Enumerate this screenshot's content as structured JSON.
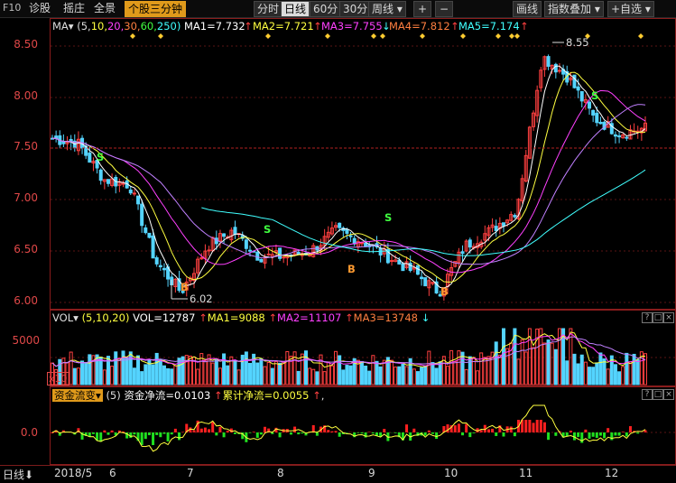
{
  "toolbar": {
    "f10": "F10",
    "diagnose": "诊股",
    "draw": "摇庄",
    "overview": "全景",
    "stock_3min": "个股三分钟",
    "timeshare": "分时",
    "daily": "日线",
    "min60": "60分",
    "min30": "30分",
    "weekly": "周线",
    "plus": "+",
    "minus": "−",
    "line_draw": "画线",
    "index_overlay": "指数叠加",
    "self_select": "+自选"
  },
  "main_legend": {
    "name": "MA▾",
    "params_open": "(5,",
    "p10": "10,",
    "p20": "20,",
    "p30": "30,",
    "p60": "60,",
    "p250": "250)",
    "ma1": "MA1=7.732",
    "ma2": "MA2=7.721",
    "ma3": "MA3=7.755",
    "ma4": "MA4=7.812",
    "ma5": "MA5=7.174",
    "up_arrow": "↑",
    "down_arrow": "↓"
  },
  "price_axis": [
    "8.50",
    "8.00",
    "7.50",
    "7.00",
    "6.50",
    "6.00"
  ],
  "annotations": {
    "high": "8.55",
    "low": "6.02",
    "buy": "B",
    "sell": "S"
  },
  "vol_legend": {
    "name": "VOL▾",
    "params": "(5,10,20)",
    "vol": "VOL=12787",
    "ma1": "MA1=9088",
    "ma2": "MA2=11107",
    "ma3": "MA3=13748"
  },
  "vol_axis": {
    "top": "5000",
    "unit": "x10"
  },
  "fund_legend": {
    "name": "资金流变▾",
    "param": "(5)",
    "net": "资金净流=0.0103",
    "cum": "累计净流=0.0055",
    "trail": ","
  },
  "fund_axis": {
    "zero": "0.0"
  },
  "bottom": {
    "period": "日线",
    "period_arrow": "⬇",
    "start": "2018/5",
    "months": [
      "6",
      "7",
      "8",
      "9",
      "10",
      "11",
      "12"
    ]
  },
  "colors": {
    "up": "#ff4040",
    "down": "#54d4ff",
    "ma5": "#ffffff",
    "ma10": "#ffff40",
    "ma20": "#ff40ff",
    "ma30": "#c080ff",
    "ma60": "#40ffff",
    "accent": "#e09a1b"
  },
  "chart_data": {
    "type": "line",
    "xlabel": "",
    "ylabel": "",
    "ylim": [
      6.0,
      8.6
    ],
    "categories": [
      "2018/5",
      "6",
      "7",
      "8",
      "9",
      "10",
      "11",
      "12"
    ],
    "price_close_approx": [
      7.6,
      7.55,
      7.2,
      7.15,
      6.4,
      6.1,
      6.55,
      6.7,
      6.45,
      6.45,
      6.5,
      6.7,
      6.6,
      6.45,
      6.3,
      6.1,
      6.55,
      6.7,
      6.9,
      8.4,
      8.2,
      7.8,
      7.65,
      7.7
    ],
    "series": [
      {
        "name": "MA1",
        "last": 7.732
      },
      {
        "name": "MA2",
        "last": 7.721
      },
      {
        "name": "MA3",
        "last": 7.755
      },
      {
        "name": "MA4",
        "last": 7.812
      },
      {
        "name": "MA5",
        "last": 7.174
      }
    ],
    "high_marker": 8.55,
    "low_marker": 6.02
  }
}
